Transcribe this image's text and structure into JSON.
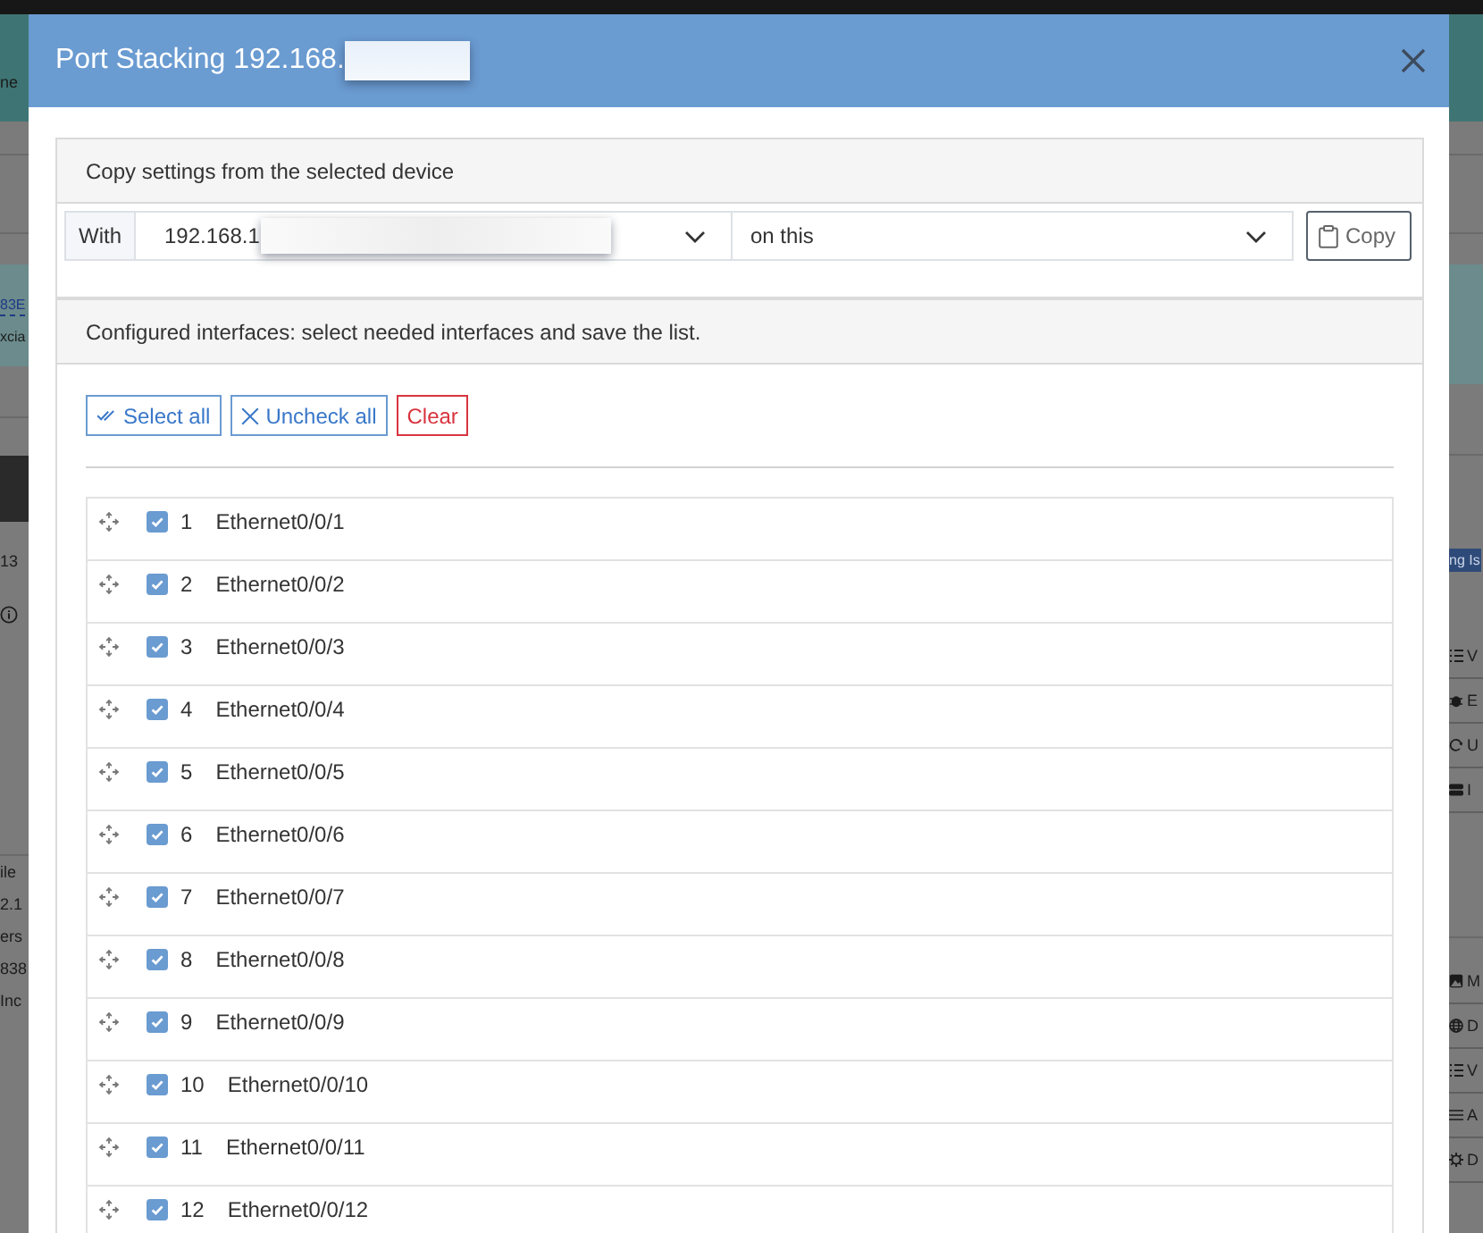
{
  "backdrop": {
    "left": {
      "band_text": "ne",
      "link": "83E",
      "link_note": "xcia",
      "count": "13",
      "details": [
        "ile",
        "2.1",
        "ers",
        "838",
        "Inc"
      ]
    },
    "right": {
      "badge": "ng Is",
      "actions": [
        {
          "kind": "list",
          "label": "V"
        },
        {
          "kind": "bug",
          "label": "E"
        },
        {
          "kind": "refresh",
          "label": "U"
        },
        {
          "kind": "bars",
          "label": "I"
        }
      ],
      "more_actions": [
        {
          "kind": "image",
          "label": "M"
        },
        {
          "kind": "globe",
          "label": "D"
        },
        {
          "kind": "list",
          "label": "V"
        },
        {
          "kind": "menu",
          "label": "A"
        },
        {
          "kind": "gear",
          "label": "D"
        }
      ]
    }
  },
  "dialog": {
    "title": "Port Stacking 192.168.",
    "copy_panel": {
      "heading": "Copy settings from the selected device",
      "with_label": "With",
      "source_device": "192.168.1",
      "target": "on this",
      "copy_button": "Copy"
    },
    "interfaces_panel": {
      "heading": "Configured interfaces: select needed interfaces and save the list.",
      "buttons": [
        {
          "kind": "select",
          "label": "Select all"
        },
        {
          "kind": "uncheck",
          "label": "Uncheck all"
        },
        {
          "kind": "clear",
          "label": "Clear"
        }
      ],
      "interfaces": [
        {
          "number": "1",
          "name": "Ethernet0/0/1",
          "checked": true
        },
        {
          "number": "2",
          "name": "Ethernet0/0/2",
          "checked": true
        },
        {
          "number": "3",
          "name": "Ethernet0/0/3",
          "checked": true
        },
        {
          "number": "4",
          "name": "Ethernet0/0/4",
          "checked": true
        },
        {
          "number": "5",
          "name": "Ethernet0/0/5",
          "checked": true
        },
        {
          "number": "6",
          "name": "Ethernet0/0/6",
          "checked": true
        },
        {
          "number": "7",
          "name": "Ethernet0/0/7",
          "checked": true
        },
        {
          "number": "8",
          "name": "Ethernet0/0/8",
          "checked": true
        },
        {
          "number": "9",
          "name": "Ethernet0/0/9",
          "checked": true
        },
        {
          "number": "10",
          "name": "Ethernet0/0/10",
          "checked": true
        },
        {
          "number": "11",
          "name": "Ethernet0/0/11",
          "checked": true
        },
        {
          "number": "12",
          "name": "Ethernet0/0/12",
          "checked": true
        }
      ]
    }
  }
}
